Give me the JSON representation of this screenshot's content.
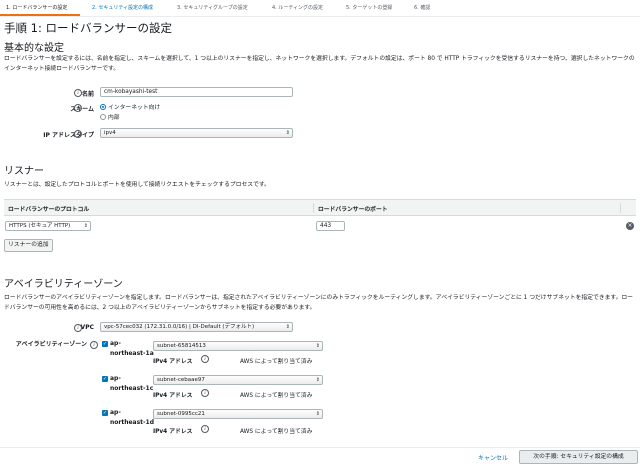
{
  "wizard": {
    "steps": [
      "1. ロードバランサーの設定",
      "2. セキュリティ設定の構成",
      "3. セキュリティグループの設定",
      "4. ルーティングの設定",
      "5. ターゲットの登録",
      "6. 確認"
    ]
  },
  "page": {
    "title": "手順 1: ロードバランサーの設定"
  },
  "basic": {
    "heading": "基本的な設定",
    "description": "ロードバランサーを設定するには、名前を指定し、スキームを選択して、1 つ以上のリスナーを指定し、ネットワークを選択します。デフォルトの設定は、ポート 80 で HTTP トラフィックを受信するリスナーを持つ、選択したネットワークのインターネット接続ロードバランサーです。",
    "name_label": "名前",
    "name_value": "cm-kobayashi-test",
    "scheme_label": "スキーム",
    "scheme_options": [
      "インターネット向け",
      "内部"
    ],
    "ip_type_label": "IP アドレスタイプ",
    "ip_type_value": "ipv4"
  },
  "listener": {
    "heading": "リスナー",
    "description": "リスナーとは、設定したプロトコルとポートを使用して接続リクエストをチェックするプロセスです。",
    "col_protocol": "ロードバランサーのプロトコル",
    "col_port": "ロードバランサーのポート",
    "protocol_value": "HTTPS (セキュア HTTP)",
    "port_value": "443",
    "add_button": "リスナーの追加"
  },
  "az": {
    "heading": "アベイラビリティーゾーン",
    "description": "ロードバランサーのアベイラビリティーゾーンを指定します。ロードバランサーは、指定されたアベイラビリティーゾーンにのみトラフィックをルーティングします。アベイラビリティーゾーンごとに 1 つだけサブネットを指定できます。ロードバランサーの可用性を高めるには、2 つ以上のアベイラビリティーゾーンからサブネットを指定する必要があります。",
    "vpc_label": "VPC",
    "vpc_value": "vpc-57cec032 (172.31.0.0/16) | DI-Default (デフォルト)",
    "zones_label": "アベイラビリティーゾーン",
    "ipv4_label": "IPv4 アドレス",
    "ipv4_value": "AWS によって割り当て済み",
    "zones": [
      {
        "name_line1": "ap-",
        "name_line2": "northeast-1a",
        "subnet": "subnet-65814513"
      },
      {
        "name_line1": "ap-",
        "name_line2": "northeast-1c",
        "subnet": "subnet-cebaae97"
      },
      {
        "name_line1": "ap-",
        "name_line2": "northeast-1d",
        "subnet": "subnet-0995cc21"
      }
    ]
  },
  "footer": {
    "cancel": "キャンセル",
    "next": "次の手順: セキュリティ設定の構成"
  }
}
